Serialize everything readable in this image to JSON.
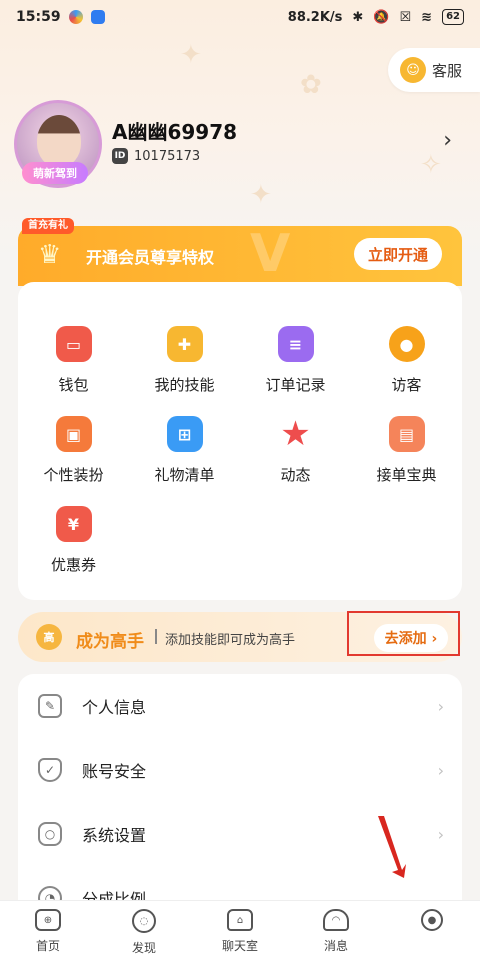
{
  "status_bar": {
    "time": "15:59",
    "net_speed": "88.2K/s",
    "battery": "62"
  },
  "service": {
    "label": "客服",
    "icon": "headset-icon"
  },
  "profile": {
    "avatar_badge": "萌新驾到",
    "username": "A幽幽69978",
    "id_label": "ID",
    "id_value": "10175173"
  },
  "vip": {
    "tag": "首充有礼",
    "text": "开通会员尊享特权",
    "watermark": "V",
    "button": "立即开通"
  },
  "features": [
    {
      "label": "钱包",
      "icon": "wallet-icon",
      "color": "#f05a4a"
    },
    {
      "label": "我的技能",
      "icon": "gamepad-icon",
      "color": "#f7b731"
    },
    {
      "label": "订单记录",
      "icon": "clipboard-icon",
      "color": "#9b6bf0"
    },
    {
      "label": "访客",
      "icon": "eye-icon",
      "color": "#f7a21a"
    },
    {
      "label": "个性装扮",
      "icon": "shirt-icon",
      "color": "#f57a3b"
    },
    {
      "label": "礼物清单",
      "icon": "gift-icon",
      "color": "#3a9bf5"
    },
    {
      "label": "动态",
      "icon": "star-icon",
      "color": "#ee4d4d"
    },
    {
      "label": "接单宝典",
      "icon": "book-icon",
      "color": "#f5845a"
    },
    {
      "label": "优惠券",
      "icon": "coupon-icon",
      "color": "#f05a4a"
    }
  ],
  "expert": {
    "medal": "高",
    "title": "成为高手",
    "subtitle": "添加技能即可成为高手",
    "button": "去添加 ›"
  },
  "settings": [
    {
      "label": "个人信息",
      "icon": "edit-icon"
    },
    {
      "label": "账号安全",
      "icon": "shield-icon"
    },
    {
      "label": "系统设置",
      "icon": "settings-icon"
    },
    {
      "label": "分成比例",
      "icon": "pie-chart-icon"
    }
  ],
  "nav": [
    {
      "label": "首页",
      "icon": "gamepad-icon"
    },
    {
      "label": "发现",
      "icon": "planet-icon"
    },
    {
      "label": "聊天室",
      "icon": "house-icon"
    },
    {
      "label": "消息",
      "icon": "bell-icon"
    },
    {
      "label": "",
      "icon": "user-icon"
    }
  ],
  "colors": {
    "accent_orange": "#ffab2a",
    "highlight_red": "#e2392f"
  }
}
